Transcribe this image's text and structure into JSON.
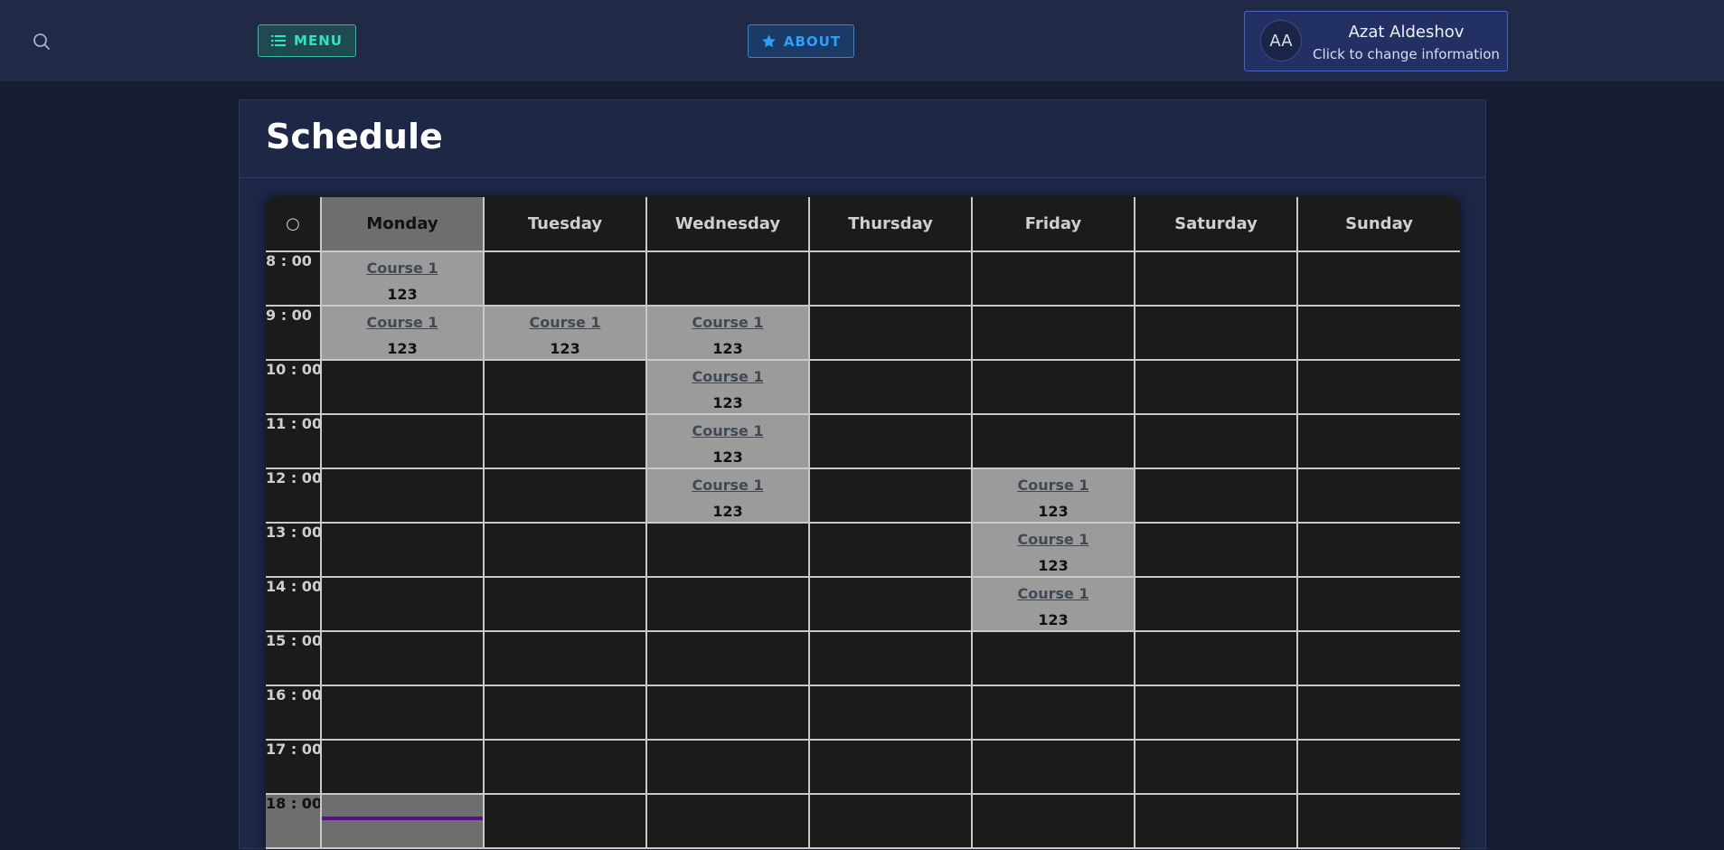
{
  "header": {
    "search_icon": "search-icon",
    "menu_label": "MENU",
    "menu_icon": "list-icon",
    "about_label": "ABOUT",
    "about_icon": "star-icon",
    "user": {
      "initials": "AA",
      "name": "Azat Aldeshov",
      "subtitle": "Click to change information"
    },
    "colors": {
      "menu_accent": "#2ee6bd",
      "about_accent": "#2aa0ff",
      "user_border": "#4a63c7"
    }
  },
  "page": {
    "title": "Schedule"
  },
  "schedule": {
    "corner_symbol": "○",
    "today": "Monday",
    "current_time_row": "18 : 00",
    "days": [
      "Monday",
      "Tuesday",
      "Wednesday",
      "Thursday",
      "Friday",
      "Saturday",
      "Sunday"
    ],
    "times": [
      "8 : 00",
      "9 : 00",
      "10 : 00",
      "11 : 00",
      "12 : 00",
      "13 : 00",
      "14 : 00",
      "15 : 00",
      "16 : 00",
      "17 : 00",
      "18 : 00"
    ],
    "entries": [
      {
        "day": "Monday",
        "time": "8 : 00",
        "course": "Course 1",
        "room": "123"
      },
      {
        "day": "Monday",
        "time": "9 : 00",
        "course": "Course 1",
        "room": "123"
      },
      {
        "day": "Tuesday",
        "time": "9 : 00",
        "course": "Course 1",
        "room": "123"
      },
      {
        "day": "Wednesday",
        "time": "9 : 00",
        "course": "Course 1",
        "room": "123"
      },
      {
        "day": "Wednesday",
        "time": "10 : 00",
        "course": "Course 1",
        "room": "123"
      },
      {
        "day": "Wednesday",
        "time": "11 : 00",
        "course": "Course 1",
        "room": "123"
      },
      {
        "day": "Wednesday",
        "time": "12 : 00",
        "course": "Course 1",
        "room": "123"
      },
      {
        "day": "Friday",
        "time": "12 : 00",
        "course": "Course 1",
        "room": "123"
      },
      {
        "day": "Friday",
        "time": "13 : 00",
        "course": "Course 1",
        "room": "123"
      },
      {
        "day": "Friday",
        "time": "14 : 00",
        "course": "Course 1",
        "room": "123"
      }
    ],
    "colors": {
      "cell_empty": "#1b1b1b",
      "cell_filled": "#9b9b9b",
      "today_highlight": "#6e6e6e",
      "now_indicator": "#5a0d8c"
    }
  }
}
